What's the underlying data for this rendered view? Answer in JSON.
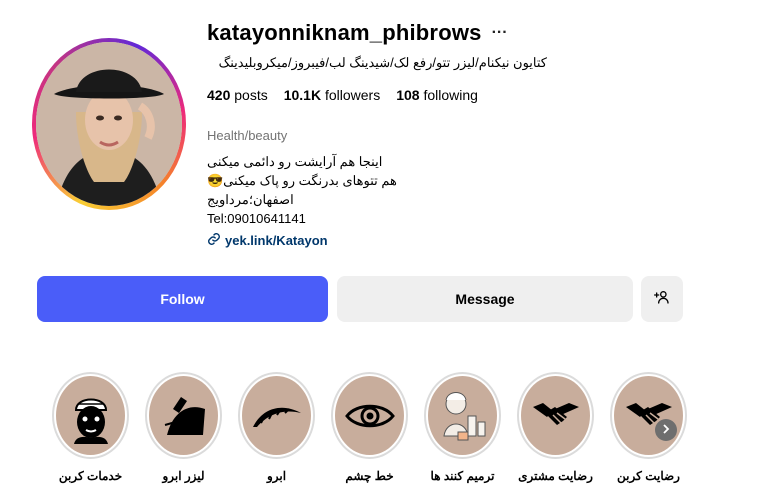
{
  "profile": {
    "username": "katayonniknam_phibrows",
    "more_icon": "more-dots-icon",
    "full_name": "کتایون نیکنام/لیزر تتو/رفع لک/شیدینگ لب/فیبروز/میکروبلیدینگ",
    "stats": {
      "posts_count": "420",
      "posts_label": "posts",
      "followers_count": "10.1K",
      "followers_label": "followers",
      "following_count": "108",
      "following_label": "following"
    },
    "category": "Health/beauty",
    "bio_lines": [
      "اینجا هم آرایشت رو دائمی میکنی",
      "هم تتوهای بدرنگت رو پاک میکنی😎",
      "اصفهان؛مرداویج",
      "Tel:09010641141"
    ],
    "link_icon": "link-icon",
    "link_text": "yek.link/Katayon"
  },
  "actions": {
    "follow_label": "Follow",
    "message_label": "Message",
    "add_user_icon": "add-user-icon"
  },
  "highlights": [
    {
      "label": "خدمات کربن",
      "icon": "face-mask-icon"
    },
    {
      "label": "لیزر ابرو",
      "icon": "laser-brow-icon"
    },
    {
      "label": "ابرو",
      "icon": "eyebrow-icon"
    },
    {
      "label": "خط چشم",
      "icon": "eye-icon"
    },
    {
      "label": "ترمیم کنند ها",
      "icon": "cream-products-icon"
    },
    {
      "label": "رضایت مشتری",
      "icon": "handshake-icon"
    },
    {
      "label": "رضایت کربن",
      "icon": "handshake-icon"
    }
  ],
  "colors": {
    "follow_button": "#4a5df9",
    "secondary_button": "#efefef",
    "link": "#00376b",
    "highlight_bg": "#c8ad9c"
  }
}
